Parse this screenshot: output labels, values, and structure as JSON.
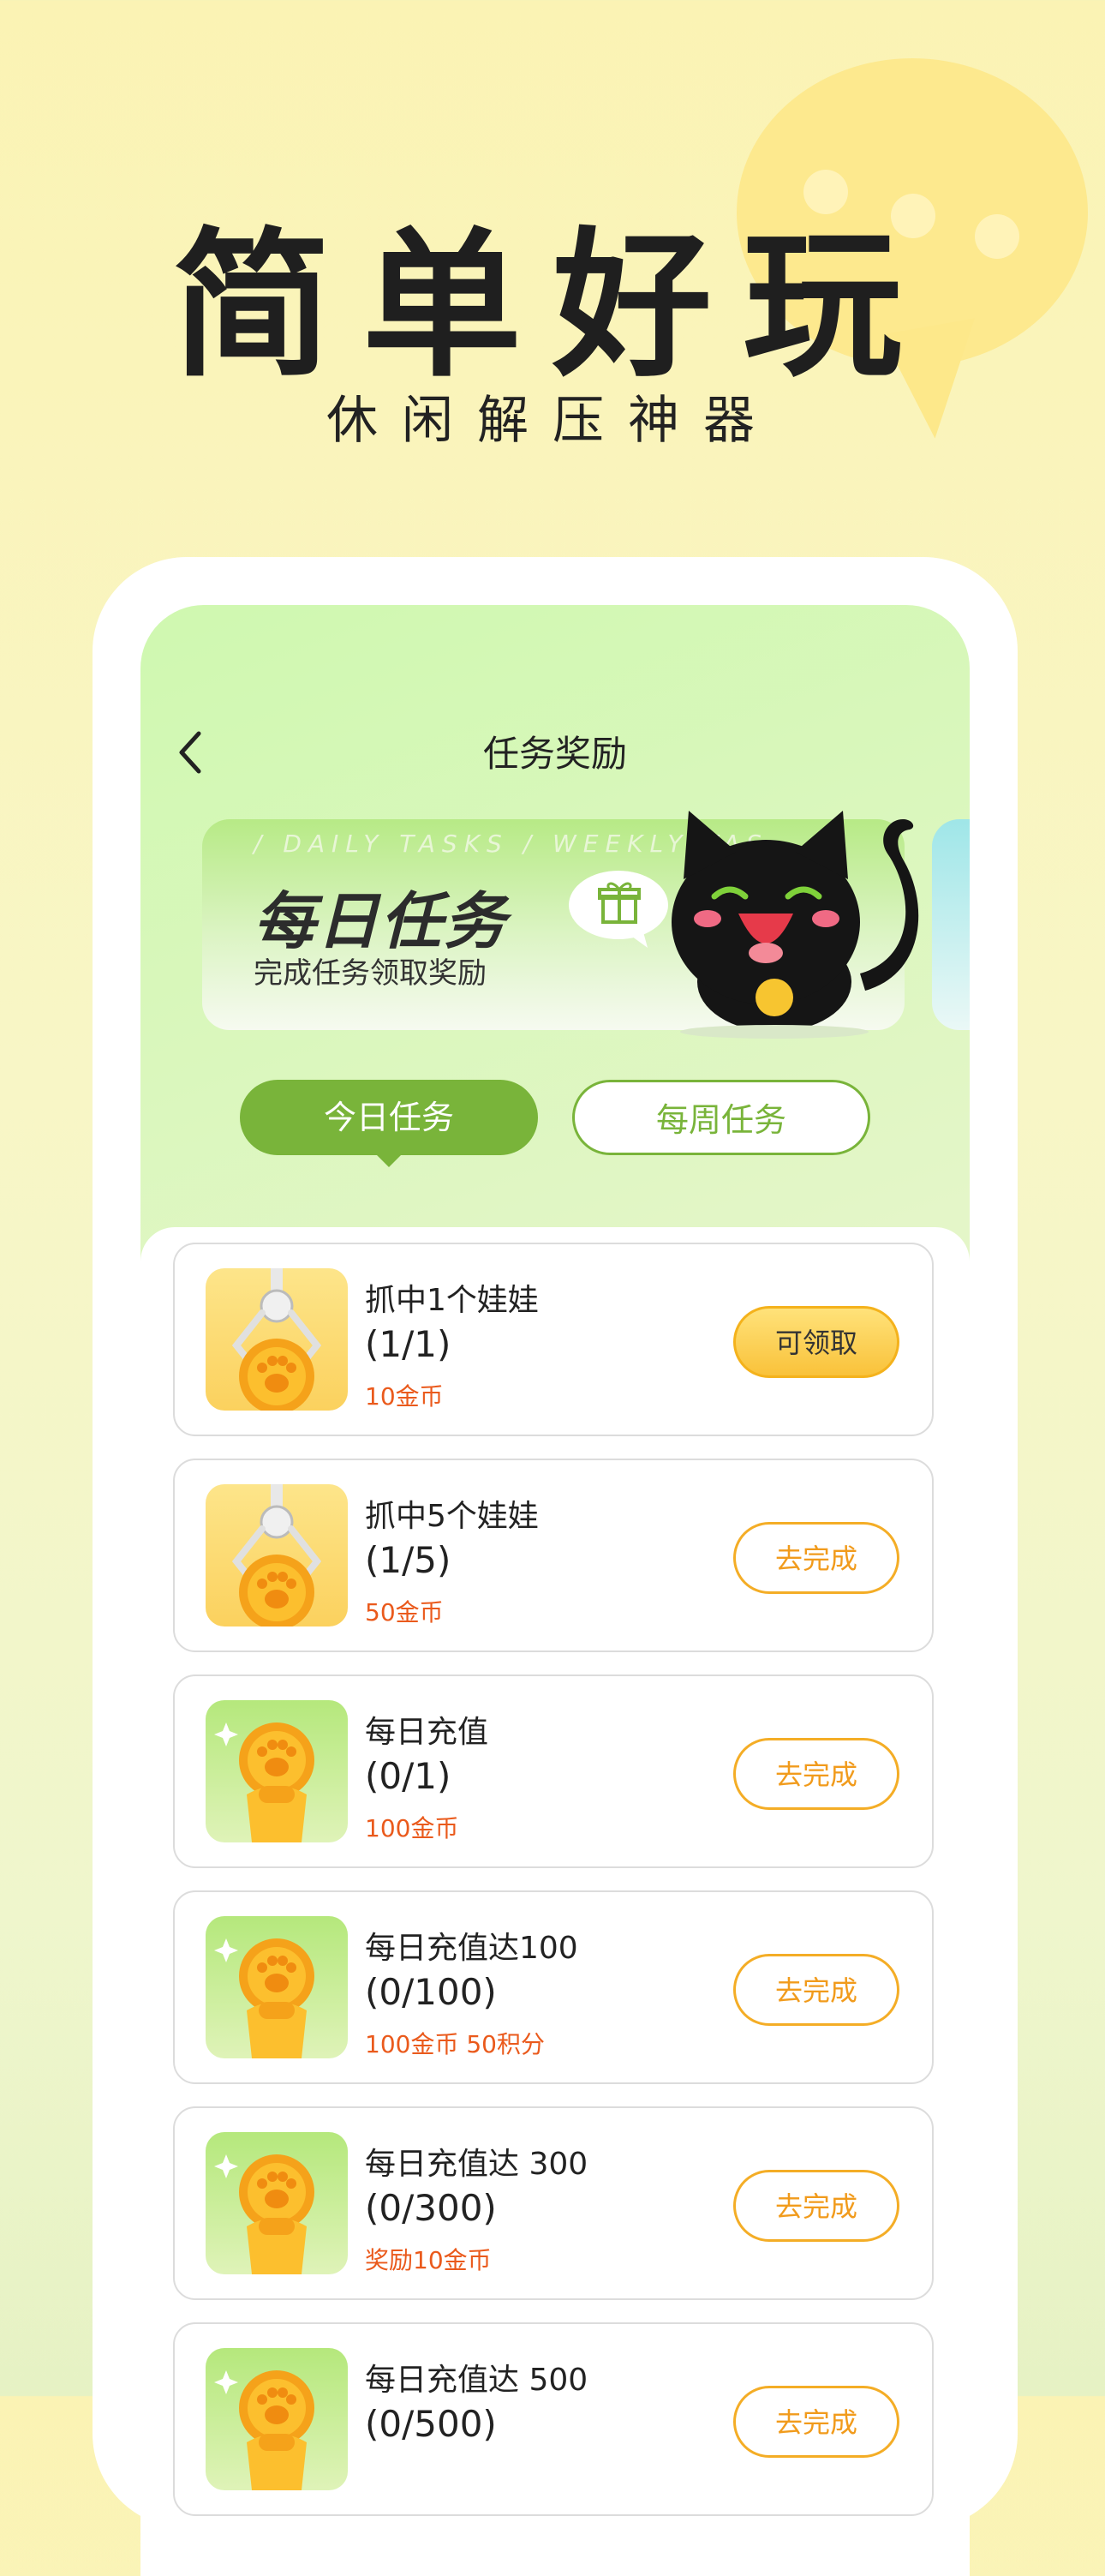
{
  "hero": {
    "title": "简单好玩",
    "subtitle": "休闲解压神器"
  },
  "nav": {
    "title": "任务奖励",
    "back_icon": "chevron-left-icon"
  },
  "banner": {
    "strip_text": "/ DAILY TASKS / WEEKLY TAS",
    "title": "每日任务",
    "subtitle": "完成任务领取奖励",
    "gift_icon": "gift-icon",
    "mascot": "black-cat-mascot"
  },
  "tabs": {
    "active": "今日任务",
    "inactive": "每周任务"
  },
  "tasks": [
    {
      "title": "抓中1个娃娃",
      "progress": "(1/1)",
      "reward": "10金币",
      "button": "可领取",
      "thumb": "claw-coin-icon",
      "state": "claim"
    },
    {
      "title": "抓中5个娃娃",
      "progress": "(1/5)",
      "reward": "50金币",
      "button": "去完成",
      "thumb": "claw-coin-icon",
      "state": "go"
    },
    {
      "title": "每日充值",
      "progress": "(0/1)",
      "reward": "100金币",
      "button": "去完成",
      "thumb": "paw-coin-icon",
      "state": "go"
    },
    {
      "title": "每日充值达100",
      "progress": "(0/100)",
      "reward": "100金币 50积分",
      "button": "去完成",
      "thumb": "paw-coin-icon",
      "state": "go"
    },
    {
      "title": "每日充值达 300",
      "progress": "(0/300)",
      "reward": "奖励10金币",
      "button": "去完成",
      "thumb": "paw-coin-icon",
      "state": "go"
    },
    {
      "title": "每日充值达 500",
      "progress": "(0/500)",
      "reward": "",
      "button": "去完成",
      "thumb": "paw-coin-icon",
      "state": "go"
    }
  ],
  "colors": {
    "accent_green": "#79b43a",
    "button_orange": "#f4ad26",
    "reward_red": "#ea5a1c"
  }
}
